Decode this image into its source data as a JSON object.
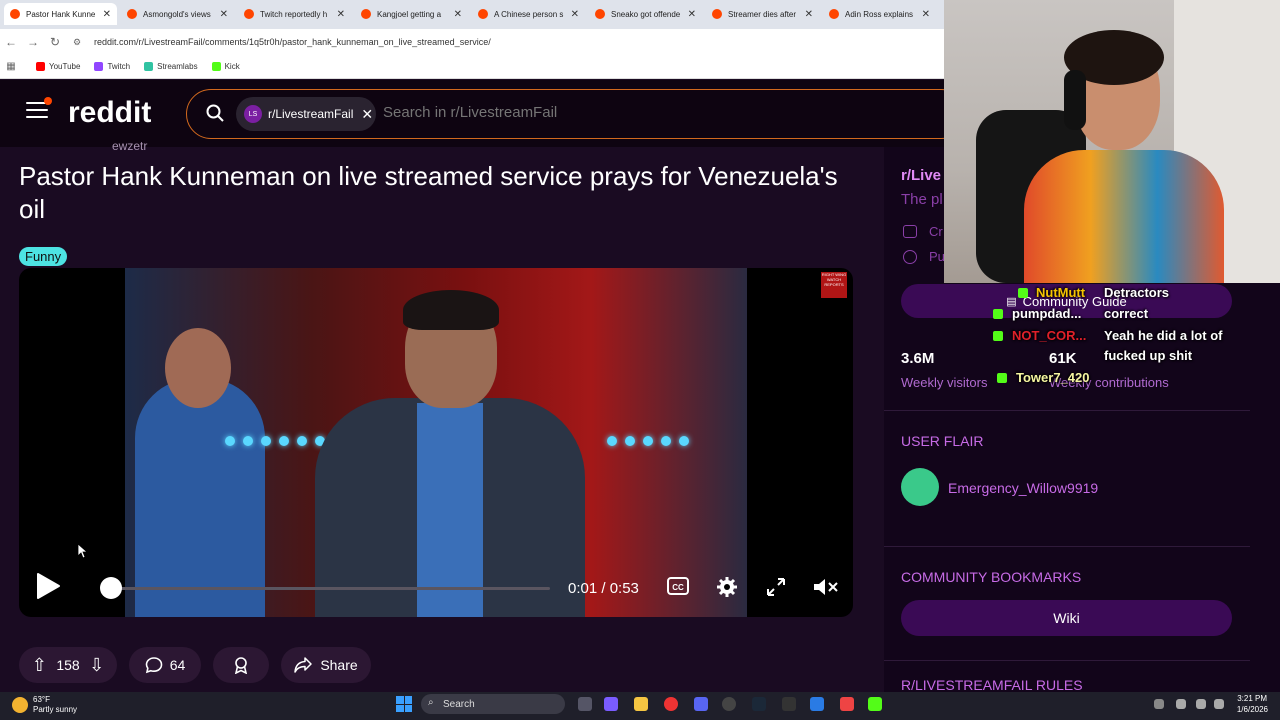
{
  "browser": {
    "tabs": [
      {
        "label": "Pastor Hank Kunne",
        "active": true
      },
      {
        "label": "Asmongold's views",
        "active": false
      },
      {
        "label": "Twitch reportedly h",
        "active": false
      },
      {
        "label": "Kangjoel getting a",
        "active": false
      },
      {
        "label": "A Chinese person s",
        "active": false
      },
      {
        "label": "Sneako got offende",
        "active": false
      },
      {
        "label": "Streamer dies after",
        "active": false
      },
      {
        "label": "Adin Ross explains",
        "active": false
      }
    ],
    "url": "reddit.com/r/LivestreamFail/comments/1q5tr0h/pastor_hank_kunneman_on_live_streamed_service/",
    "bookmarks": [
      "YouTube",
      "Twitch",
      "Streamlabs",
      "Kick"
    ]
  },
  "reddit": {
    "logo": "reddit",
    "search_chip": "r/LivestreamFail",
    "search_chip_badge": "LS",
    "search_placeholder": "Search in r/LivestreamFail"
  },
  "post": {
    "author": "ewzetr",
    "title": "Pastor Hank Kunneman on live streamed service prays for Venezuela's oil",
    "flair": "Funny",
    "video": {
      "time": "0:01 / 0:53",
      "progress": 0.02,
      "watermark": "RIGHT WING WATCH REPORTS"
    },
    "actions": {
      "votes": "158",
      "comments": "64",
      "share": "Share"
    }
  },
  "sidebar": {
    "sub_name": "r/Live",
    "sub_desc": "The pl",
    "created": "Cr",
    "visibility": "Pu",
    "guide_button": "Community Guide",
    "visitors_num": "3.6M",
    "visitors_label": "Weekly visitors",
    "contrib_num": "61K",
    "contrib_label": "Weekly contributions",
    "user_flair_header": "USER FLAIR",
    "user_flair_name": "Emergency_Willow9919",
    "bookmarks_header": "COMMUNITY BOOKMARKS",
    "wiki_button": "Wiki",
    "rules_header": "R/LIVESTREAMFAIL RULES"
  },
  "chat": [
    {
      "user": "NutMutt",
      "message": "Detractors",
      "color": "#f5c400"
    },
    {
      "user": "pumpdad...",
      "message": "correct",
      "color": "#ffffff"
    },
    {
      "user": "NOT_COR...",
      "message": "Yeah he did a lot of",
      "color": "#e0202a"
    },
    {
      "user": "",
      "message": "fucked up shit",
      "color": "#ffffff"
    },
    {
      "user": "Tower7_420",
      "message": "",
      "color": "#f5f5a0"
    }
  ],
  "taskbar": {
    "temp": "63°F",
    "weather": "Partly sunny",
    "search": "Search",
    "time": "3:21 PM",
    "date": "1/6/2026"
  },
  "colors": {
    "accent": "#ff4500",
    "sidebar_accent": "#c76be6",
    "kick_green": "#53fc18"
  }
}
